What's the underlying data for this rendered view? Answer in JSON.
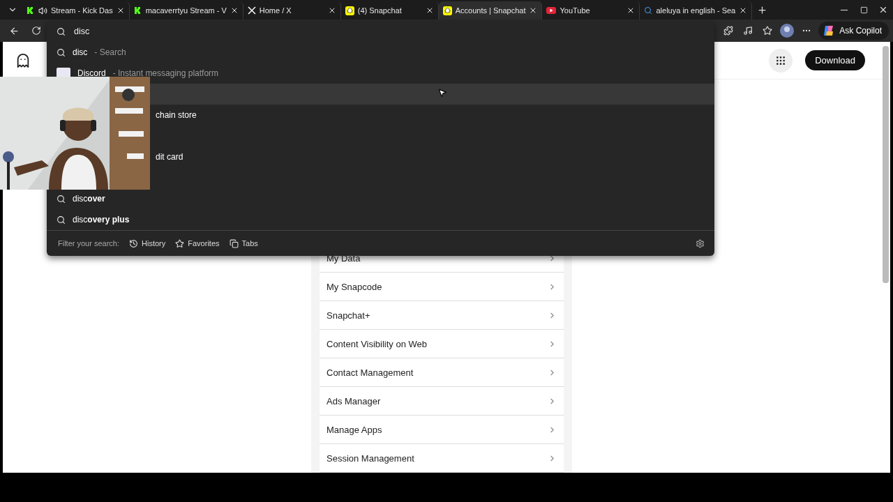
{
  "tabs": [
    {
      "kind": "kick",
      "title": "Stream - Kick Das",
      "audio": true,
      "selected": false
    },
    {
      "kind": "kick",
      "title": "macaverrtyu Stream - V",
      "audio": false,
      "selected": false
    },
    {
      "kind": "x",
      "title": "Home / X",
      "audio": false,
      "selected": false
    },
    {
      "kind": "snapchat",
      "title": "(4) Snapchat",
      "audio": false,
      "selected": false
    },
    {
      "kind": "snapchat",
      "title": "Accounts | Snapchat",
      "audio": false,
      "selected": true
    },
    {
      "kind": "youtube",
      "title": "YouTube",
      "audio": false,
      "selected": false
    },
    {
      "kind": "search",
      "title": "aleluya in english - Sea",
      "audio": false,
      "selected": false
    }
  ],
  "address": {
    "value": "disc"
  },
  "copilot": "Ask Copilot",
  "suggestions": [
    {
      "kind": "search",
      "title": "disc",
      "detail": "- Search",
      "selected": false
    },
    {
      "kind": "site",
      "title": "Discord",
      "detail": "- Instant messaging platform",
      "selected": false
    },
    {
      "kind": "hidden",
      "selected": true
    },
    {
      "kind": "partial",
      "title": "chain store",
      "selected": false
    },
    {
      "kind": "hidden",
      "selected": false
    },
    {
      "kind": "partial",
      "title": "dit card",
      "selected": false
    },
    {
      "kind": "hidden",
      "selected": false
    },
    {
      "kind": "search",
      "title": "disc**over**",
      "selected": false
    },
    {
      "kind": "search",
      "title": "disc**overy plus**",
      "selected": false
    }
  ],
  "filter": {
    "label": "Filter your search:",
    "options": [
      {
        "kind": "history",
        "label": "History"
      },
      {
        "kind": "favorites",
        "label": "Favorites"
      },
      {
        "kind": "tabs",
        "label": "Tabs"
      }
    ]
  },
  "page": {
    "download": "Download",
    "menu": [
      "My Data",
      "My Snapcode",
      "Snapchat+",
      "Content Visibility on Web",
      "Contact Management",
      "Ads Manager",
      "Manage Apps",
      "Session Management"
    ]
  }
}
